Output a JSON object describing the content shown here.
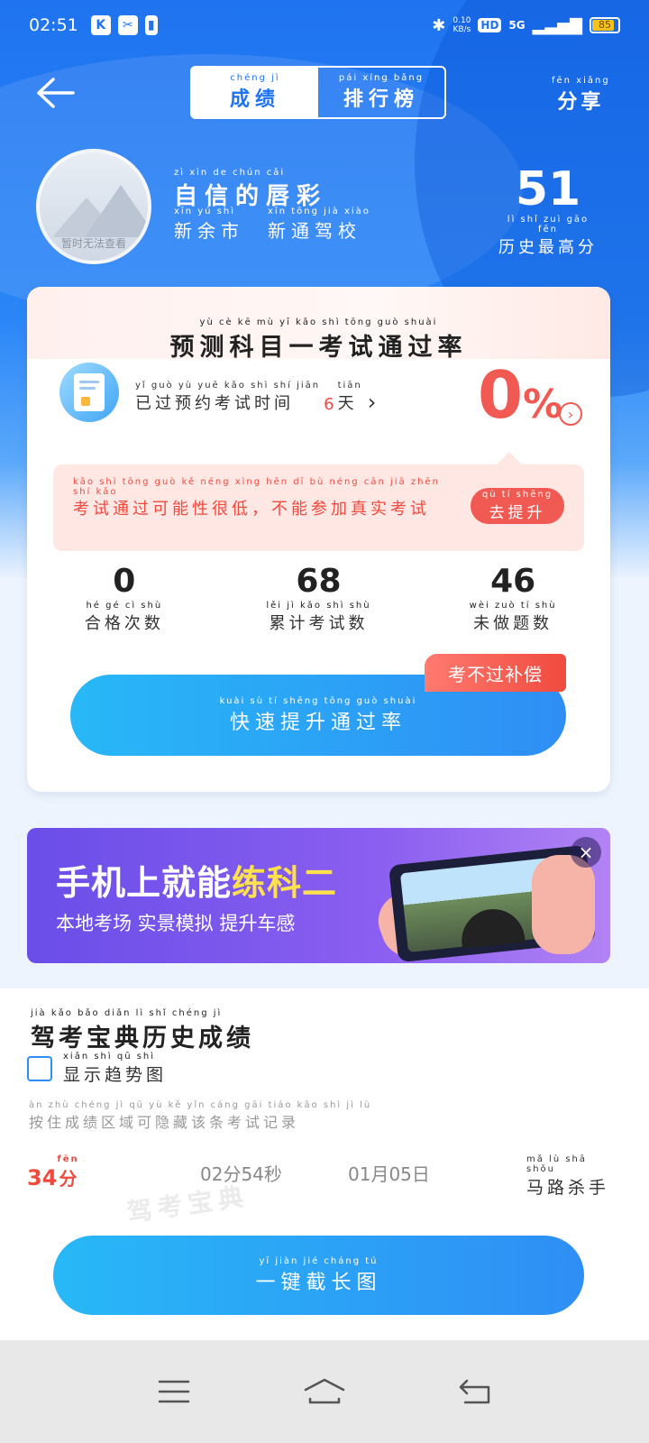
{
  "status_bar": {
    "time": "02:51",
    "net_speed": "0.10",
    "net_unit": "KB/s",
    "hd": "HD",
    "signal": "5G",
    "battery": "85",
    "battery_level": 0.85
  },
  "header": {
    "tabs": [
      {
        "pinyin": "chéng  jì",
        "label": "成绩",
        "active": true
      },
      {
        "pinyin": "pái  xíng  bǎng",
        "label": "排行榜",
        "active": false
      }
    ],
    "share": {
      "pinyin": "fēn  xiǎng",
      "label": "分享"
    }
  },
  "profile": {
    "avatar_caption": "暂时无法查看",
    "name_pinyin": "zì  xìn  de  chún  cǎi",
    "name": "自信的唇彩",
    "city_pinyin": "xīn  yú  shì",
    "city": "新余市",
    "school_pinyin": "xīn  tōng  jià  xiào",
    "school": "新通驾校",
    "best_score": "51",
    "best_label_pinyin": "lì  shǐ  zuì  gāo  fēn",
    "best_label": "历史最高分"
  },
  "card": {
    "title_pinyin": "yù  cè  kē  mù  yī  kǎo  shì  tōng  guò  shuài",
    "title": "预测科目一考试通过率",
    "appt_pinyin": "yǐ  guò  yù  yuē  kǎo  shì  shí  jiān",
    "appt_text": "已过预约考试时间",
    "appt_days": "6",
    "appt_unit_pinyin": "tiān",
    "appt_unit": "天",
    "rate_value": "0",
    "rate_unit": "%",
    "warning_pinyin": "kǎo  shì  tōng  guò  kě  néng  xìng  hěn  dī     bù  néng  cān  jiā  zhēn  shí  kǎo",
    "warning": "考试通过可能性很低，不能参加真实考试",
    "go_pinyin": "qù  tí  shēng",
    "go_label": "去提升",
    "stats": [
      {
        "value": "0",
        "pinyin": "hé  gé  cì  shù",
        "label": "合格次数"
      },
      {
        "value": "68",
        "pinyin": "lěi  jì  kǎo  shì  shù",
        "label": "累计考试数"
      },
      {
        "value": "46",
        "pinyin": "wèi  zuò  tí  shù",
        "label": "未做题数"
      }
    ],
    "badge": "考不过补偿",
    "boost_pinyin": "kuài  sù  tí  shēng  tōng  guò  shuài",
    "boost_label": "快速提升通过率"
  },
  "ad": {
    "title_a": "手机上就能",
    "title_b": "练科二",
    "subtitle": "本地考场 实景模拟 提升车感",
    "close": "×"
  },
  "history": {
    "title_pinyin": "jià  kǎo  bǎo  diǎn  lì  shǐ  chéng  jì",
    "title": "驾考宝典历史成绩",
    "trend_pinyin": "xiǎn  shì  qū  shì",
    "trend_label": "显示趋势图",
    "hint_pinyin": "àn  zhù  chéng  jì  qū  yù  kě  yǐn  cáng  gāi  tiáo  kǎo  shì  jì  lù",
    "hint": "按住成绩区域可隐藏该条考试记录",
    "record": {
      "score": "34",
      "score_unit_pinyin": "fēn",
      "score_unit": "分",
      "duration": "02分54秒",
      "date": "01月05日",
      "title_pinyin": "mǎ  lù  shā  shǒu",
      "title": "马路杀手"
    },
    "watermark": "驾考宝典",
    "screenshot_pinyin": "yī  jiàn  jié  cháng  tú",
    "screenshot_label": "一键截长图"
  }
}
